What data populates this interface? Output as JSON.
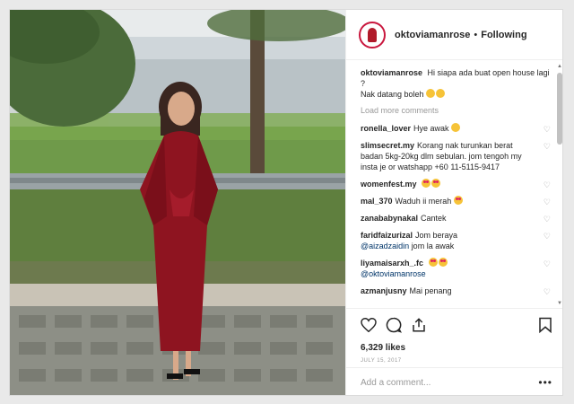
{
  "post": {
    "username": "oktoviamanrose",
    "separator": "•",
    "follow_status": "Following",
    "caption_user": "oktoviamanrose",
    "caption_line1": "Hi siapa ada buat open house lagi ?",
    "caption_line2": "Nak datang boleh",
    "load_more": "Load more comments",
    "likes": "6,329 likes",
    "date": "JULY 15, 2017",
    "add_comment_placeholder": "Add a comment...",
    "more_label": "•••"
  },
  "comments": [
    {
      "user": "ronella_lover",
      "text": "Hye awak",
      "emoji": [
        "smile"
      ]
    },
    {
      "user": "slimsecret.my",
      "text": "Korang nak turunkan berat badan 5kg-20kg dlm sebulan. jom tengoh my insta je or watshapp +60 11-5115-9417",
      "emoji": []
    },
    {
      "user": "womenfest.my",
      "text": "",
      "emoji": [
        "heart-eyes",
        "heart-eyes"
      ]
    },
    {
      "user": "mal_370",
      "text": "Waduh ii merah",
      "emoji": [
        "heart-eyes"
      ]
    },
    {
      "user": "zanababynakal",
      "text": "Cantek",
      "emoji": []
    },
    {
      "user": "faridfaizurizal",
      "text": "Jom beraya",
      "mention": "@aizadzaidin",
      "after": "jom la awak",
      "emoji": []
    },
    {
      "user": "liyamaisarxh_.fc",
      "text": "",
      "emoji": [
        "heart-eyes",
        "heart-eyes"
      ],
      "mention": "@oktoviamanrose"
    },
    {
      "user": "azmanjusny",
      "text": "Mai penang",
      "emoji": []
    }
  ],
  "icons": [
    "heart-icon",
    "comment-icon",
    "share-icon",
    "bookmark-icon"
  ]
}
